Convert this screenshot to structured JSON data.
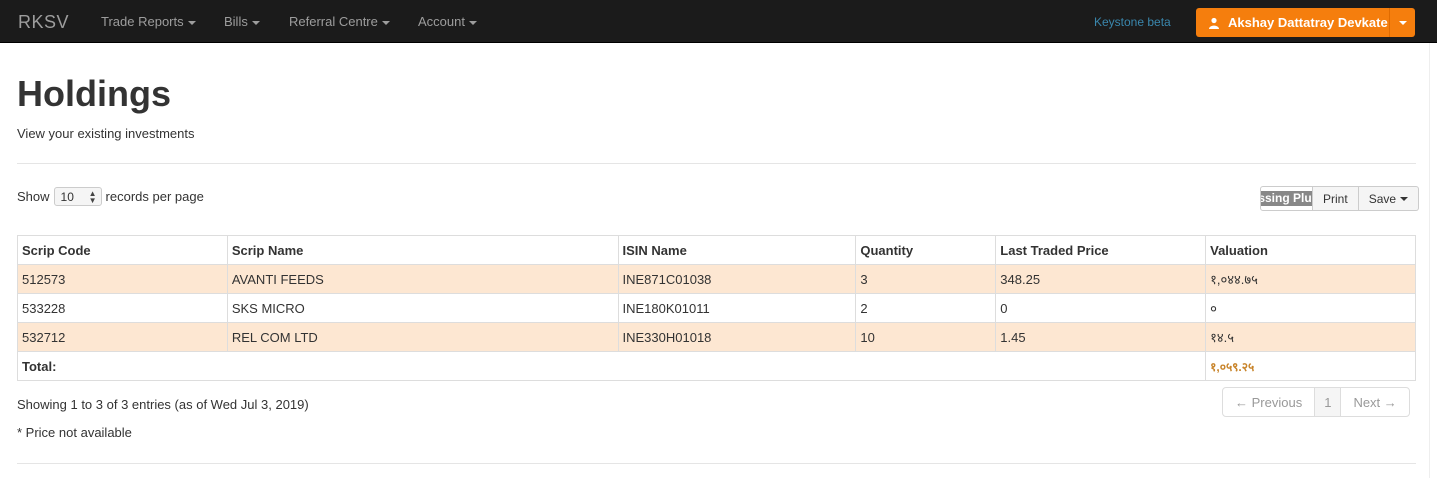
{
  "navbar": {
    "brand": "RKSV",
    "menu": [
      {
        "label": "Trade Reports"
      },
      {
        "label": "Bills"
      },
      {
        "label": "Referral Centre"
      },
      {
        "label": "Account"
      }
    ],
    "keystone": "Keystone beta",
    "user_name": "Akshay Dattatray Devkate"
  },
  "header": {
    "title": "Holdings",
    "subtitle": "View your existing investments"
  },
  "controls": {
    "show_label": "Show",
    "page_size": "10",
    "per_page_label": "records per page",
    "plugin_label": "issing Plug",
    "print_label": "Print",
    "save_label": "Save"
  },
  "table": {
    "headers": [
      "Scrip Code",
      "Scrip Name",
      "ISIN Name",
      "Quantity",
      "Last Traded Price",
      "Valuation"
    ],
    "rows": [
      [
        "512573",
        "AVANTI FEEDS",
        "INE871C01038",
        "3",
        "348.25",
        "१,०४४.७५"
      ],
      [
        "533228",
        "SKS MICRO",
        "INE180K01011",
        "2",
        "0",
        "०"
      ],
      [
        "532712",
        "REL COM LTD",
        "INE330H01018",
        "10",
        "1.45",
        "१४.५"
      ]
    ],
    "total_label": "Total:",
    "total_value": "१,०५९.२५"
  },
  "footer": {
    "info": "Showing 1 to 3 of 3 entries (as of Wed Jul 3, 2019)",
    "note": "* Price not available",
    "prev": "← Previous",
    "page": "1",
    "next": "Next →"
  },
  "colors": {
    "navbar_bg": "#1b1b1b",
    "accent_orange": "#f57e0d",
    "row_highlight": "#fde7d2",
    "keystone_link": "#3a87ad",
    "total_value": "#c8842a"
  }
}
